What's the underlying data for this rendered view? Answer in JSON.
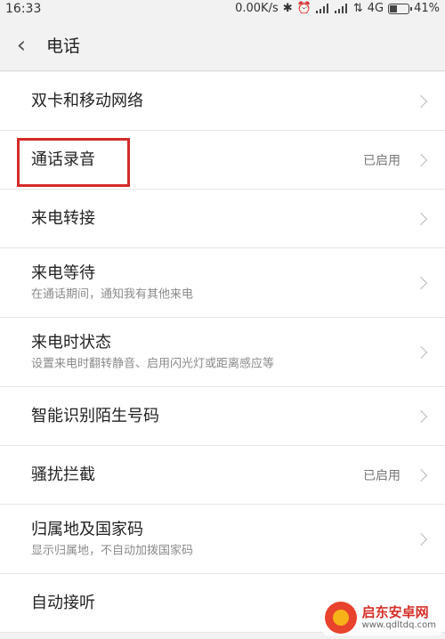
{
  "status_bar": {
    "time": "16:33",
    "net_speed": "0.00K/s",
    "network": "4G",
    "battery_text": "41%",
    "battery_level": 0.41
  },
  "header": {
    "back_icon": "chevron-left",
    "title": "电话"
  },
  "items": [
    {
      "title": "双卡和移动网络",
      "subtitle": "",
      "status": ""
    },
    {
      "title": "通话录音",
      "subtitle": "",
      "status": "已启用"
    },
    {
      "title": "来电转接",
      "subtitle": "",
      "status": ""
    },
    {
      "title": "来电等待",
      "subtitle": "在通话期间，通知我有其他来电",
      "status": ""
    },
    {
      "title": "来电时状态",
      "subtitle": "设置来电时翻转静音、启用闪光灯或距离感应等",
      "status": ""
    },
    {
      "title": "智能识别陌生号码",
      "subtitle": "",
      "status": ""
    },
    {
      "title": "骚扰拦截",
      "subtitle": "",
      "status": "已启用"
    },
    {
      "title": "归属地及国家码",
      "subtitle": "显示归属地，不自动加拨国家码",
      "status": ""
    },
    {
      "title": "自动接听",
      "subtitle": "",
      "status": ""
    }
  ],
  "annotation": {
    "color": "#d42a2a"
  },
  "watermark": {
    "name": "启东安卓网",
    "url": "www.qdltdq.com"
  }
}
